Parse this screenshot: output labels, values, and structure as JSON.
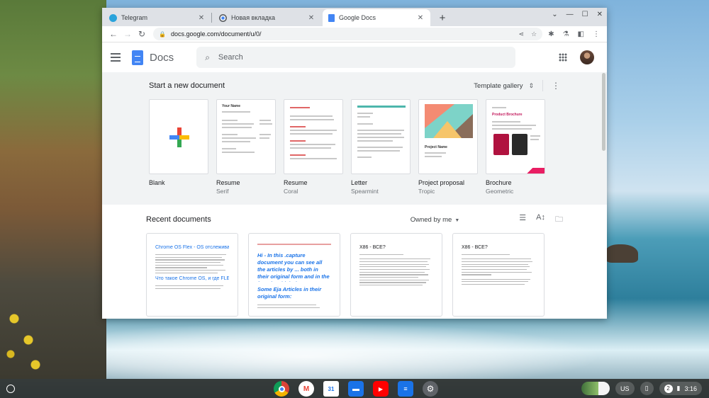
{
  "tabs": [
    {
      "title": "Telegram",
      "icon": "telegram-icon",
      "color": "#2aa3db",
      "active": false
    },
    {
      "title": "Новая вкладка",
      "icon": "chrome-icon",
      "color": "#5f6368",
      "active": false
    },
    {
      "title": "Google Docs",
      "icon": "docs-icon",
      "color": "#4285f4",
      "active": true
    }
  ],
  "omnibox": {
    "url": "docs.google.com/document/u/0/"
  },
  "header": {
    "app_name": "Docs",
    "search_placeholder": "Search"
  },
  "templates": {
    "heading": "Start a new document",
    "gallery_label": "Template gallery",
    "items": [
      {
        "name": "Blank",
        "sub": ""
      },
      {
        "name": "Resume",
        "sub": "Serif",
        "thumb_heading": "Your Name"
      },
      {
        "name": "Resume",
        "sub": "Coral"
      },
      {
        "name": "Letter",
        "sub": "Spearmint"
      },
      {
        "name": "Project proposal",
        "sub": "Tropic",
        "thumb_heading": "Project Name"
      },
      {
        "name": "Brochure",
        "sub": "Geometric",
        "thumb_heading": "Product Brochure"
      }
    ]
  },
  "recent": {
    "heading": "Recent documents",
    "owner_filter": "Owned by me",
    "docs": [
      {
        "title": "Chrome OS Flex - OS отслеживает время",
        "sub": "Что такое Chrome OS, и где FLEX?"
      },
      {
        "title": "Hi - In this .capture document you can see all the articles by ... both in their original form and in the form in which they are on the IT portals lif-online.ru, and sptit.ru !",
        "sub": "Some Eja Articles in their original form:"
      },
      {
        "title": "X86 - ВСЕ?",
        "sub": ""
      },
      {
        "title": "X86 - ВСЕ?",
        "sub": ""
      }
    ]
  },
  "shelf": {
    "apps": [
      {
        "name": "chrome-app-icon",
        "color": "#db4437"
      },
      {
        "name": "gmail-app-icon",
        "color": "#ea4335"
      },
      {
        "name": "calendar-app-icon",
        "color": "#1a73e8"
      },
      {
        "name": "files-app-icon",
        "color": "#1a73e8"
      },
      {
        "name": "youtube-app-icon",
        "color": "#ff0000"
      },
      {
        "name": "messages-app-icon",
        "color": "#1a73e8"
      },
      {
        "name": "settings-app-icon",
        "color": "#5f6368"
      }
    ],
    "input_method": "US",
    "notification_count": "2",
    "time": "3:16"
  }
}
